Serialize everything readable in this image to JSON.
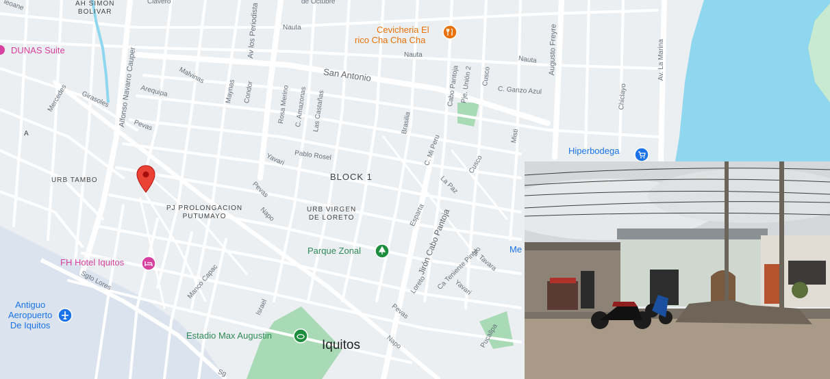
{
  "map": {
    "city": "Iquitos",
    "block": "BLOCK 1",
    "areas": {
      "urb_tambo": "URB TAMBO",
      "pj_prolongacion": "PJ PROLONGACION",
      "putumayo": "PUTUMAYO",
      "urb_virgen": "URB VIRGEN",
      "de_loreto": "DE LORETO",
      "ah_simon": "AH SIMON",
      "bolivar": "BOLIVAR",
      "a": "A"
    },
    "pois": {
      "dunas": "DUNAS Suite",
      "fh_hotel": "FH Hotel Iquitos",
      "antiguo1": "Antiguo",
      "antiguo2": "Aeropuerto",
      "antiguo3": "De Iquitos",
      "estadio": "Estadio Max Augustin",
      "parque": "Parque Zonal",
      "cevicheria1": "Cevicheria El",
      "cevicheria2": "rico Cha Cha Cha",
      "hiperbodega": "Hiperbodega"
    },
    "streets": {
      "nauta": "Nauta",
      "nauta2": "Nauta",
      "nauta3": "Nauta",
      "san_antonio": "San Antonio",
      "av_periodista": "Av los Periodista",
      "alfonso": "Alfonso Navarro Cauper",
      "augusto": "Augusto Freyre",
      "la_marina": "Av. La Marina",
      "malvinas": "Malvinas",
      "arequipa": "Arequipa",
      "mercedes": "Mercedes",
      "girasoles": "Girasoles",
      "pevas": "Pevas",
      "pevas2": "Pevas",
      "pevas3": "Pevas",
      "maynas": "Maynas",
      "condor": "Condor",
      "rosa_merino": "Rosa Merino",
      "c_amazonas": "C. Amazonas",
      "las_castanas": "Las Castañas",
      "brasilia": "Brasilia",
      "cabo_pantoja": "Cabo Pantoja",
      "pje_union": "Pje. Unión 2",
      "cusco": "Cusco",
      "cusco2": "Cusco",
      "c_ganzo": "C. Ganzo Azul",
      "chiclayo": "Chiclayo",
      "pablo_rosel": "Pablo Rosel",
      "yavari": "Yavari",
      "yavari2": "Yavari",
      "c_mi_peru": "C. Mi Peru",
      "la_paz": "La Paz",
      "esparta": "Esparta",
      "jiron": "Jirón Cabo Pantoja",
      "napo": "Napo",
      "napo2": "Napo",
      "manco": "Manco Capac",
      "sgto_lores": "Sgto Lores",
      "israel": "Israel",
      "loreto": "Loreto",
      "ca_teniente": "Ca Teniente Pinglo",
      "jr_tavara": "Jr. Tavara",
      "pucallpa": "Pucallpa",
      "misti": "Misti",
      "me": "Me",
      "clavero": "Clavero",
      "de_octubre": "de Octubre",
      "ieoane": "ieoane",
      "sg": "Sg"
    },
    "colors": {
      "background": "#f1f3f4",
      "road": "#ffffff",
      "river": "#8fd7ee",
      "river_left": "#d9e2f0",
      "park": "#a8dab5",
      "pin": "#ea4335",
      "pink": "#d6409f",
      "blue_icon": "#1a73e8",
      "green": "#1e8e3e",
      "orange": "#e8710a"
    },
    "icons": {
      "location_pin": "map-pin-icon",
      "hotel": "hotel-bed-icon",
      "airport": "airplane-icon",
      "stadium": "stadium-icon",
      "park": "tree-icon",
      "restaurant": "fork-knife-icon",
      "shopping": "shopping-cart-icon"
    }
  },
  "photo": {
    "subject": "street-building-photo"
  }
}
